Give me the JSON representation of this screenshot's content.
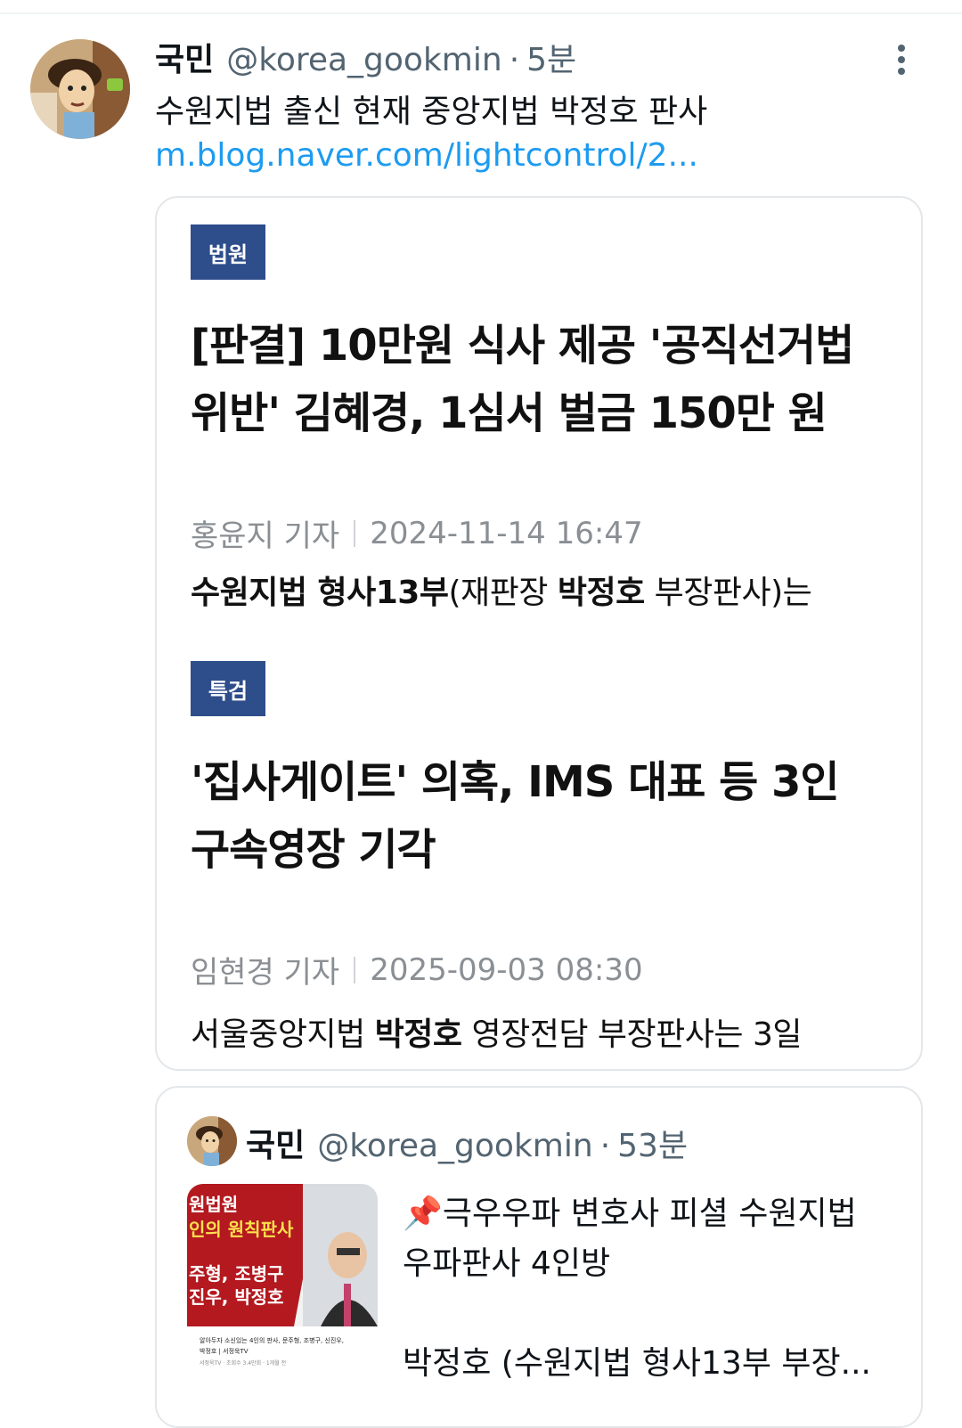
{
  "tweet": {
    "name": "국민",
    "handle": "@korea_gookmin",
    "separator": "·",
    "time": "5분",
    "text": "수원지법 출신 현재 중앙지법 박정호 판사",
    "link": "m.blog.naver.com/lightcontrol/2..."
  },
  "card": {
    "articles": [
      {
        "tag": "법원",
        "headline_line1": "[판결] 10만원 식사 제공 '공직선거법",
        "headline_line2": "위반' 김혜경, 1심서 벌금 150만 원",
        "reporter": "홍윤지 기자",
        "date": "2024-11-14 16:47",
        "snippet": [
          "수원지법 형사13부",
          "(재판장 ",
          "박정호",
          " 부장판사)는"
        ]
      },
      {
        "tag": "특검",
        "headline_line1": "'집사게이트' 의혹, IMS 대표 등 3인",
        "headline_line2": "구속영장 기각",
        "reporter": "임현경 기자",
        "date": "2025-09-03 08:30",
        "snippet": [
          "서울중앙지법 ",
          "박정호",
          " 영장전담 부장판사는 3일"
        ]
      }
    ]
  },
  "quote": {
    "name": "국민",
    "handle": "@korea_gookmin",
    "separator": "·",
    "time": "53분",
    "text_line1": "📌극우우파 변호사 피셜 수원지법",
    "text_line2": "우파판사 4인방",
    "text_line3": "박정호 (수원지법 형사13부 부장...",
    "thumbnail": {
      "line1": "원법원",
      "line2": "인의 원칙판사",
      "line3": "주형, 조병구",
      "line4": "진우, 박정호",
      "caption1": "알아두자 소신있는 4인의 판사, 문주형, 조병구, 신진우,",
      "caption2": "박정호 | 서정욱TV",
      "caption3": "서정욱TV · 조회수 3.4만회 · 1개월 전"
    }
  },
  "colors": {
    "link": "#1d9bf0",
    "tag_bg": "#2e4d8b",
    "muted": "#536471"
  }
}
